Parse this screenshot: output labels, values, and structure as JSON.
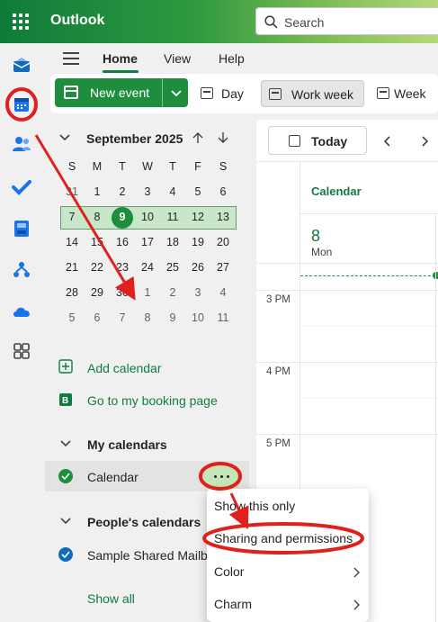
{
  "app": {
    "title": "Outlook",
    "accent": "#107c41"
  },
  "search": {
    "placeholder": "Search"
  },
  "rail": {
    "icons": [
      "mail-icon",
      "calendar-icon",
      "people-icon",
      "todo-icon",
      "files-icon",
      "org-icon",
      "onedrive-icon",
      "apps-icon"
    ]
  },
  "tabs": [
    {
      "label": "Home"
    },
    {
      "label": "View"
    },
    {
      "label": "Help"
    }
  ],
  "toolbar": {
    "new_event": "New event",
    "day": "Day",
    "work_week": "Work week",
    "week": "Week"
  },
  "minical": {
    "title": "September 2025",
    "dows": [
      "S",
      "M",
      "T",
      "W",
      "T",
      "F",
      "S"
    ],
    "weeks": [
      [
        "31",
        "1",
        "2",
        "3",
        "4",
        "5",
        "6"
      ],
      [
        "7",
        "8",
        "9",
        "10",
        "11",
        "12",
        "13"
      ],
      [
        "14",
        "15",
        "16",
        "17",
        "18",
        "19",
        "20"
      ],
      [
        "21",
        "22",
        "23",
        "24",
        "25",
        "26",
        "27"
      ],
      [
        "28",
        "29",
        "30",
        "1",
        "2",
        "3",
        "4"
      ],
      [
        "5",
        "6",
        "7",
        "8",
        "9",
        "10",
        "11"
      ]
    ]
  },
  "links": {
    "add_calendar": "Add calendar",
    "booking": "Go to my booking page"
  },
  "my_calendars": {
    "header": "My calendars",
    "item": "Calendar"
  },
  "peoples_calendars": {
    "header": "People's calendars",
    "item": "Sample Shared Mailbo",
    "show_all": "Show all"
  },
  "main": {
    "today": "Today",
    "column_title": "Calendar",
    "day_number": "8",
    "day_name": "Mon",
    "hours": [
      "3 PM",
      "4 PM",
      "5 PM"
    ]
  },
  "context_menu": {
    "items": [
      "Show this only",
      "Sharing and permissions",
      "Color",
      "Charm"
    ]
  }
}
